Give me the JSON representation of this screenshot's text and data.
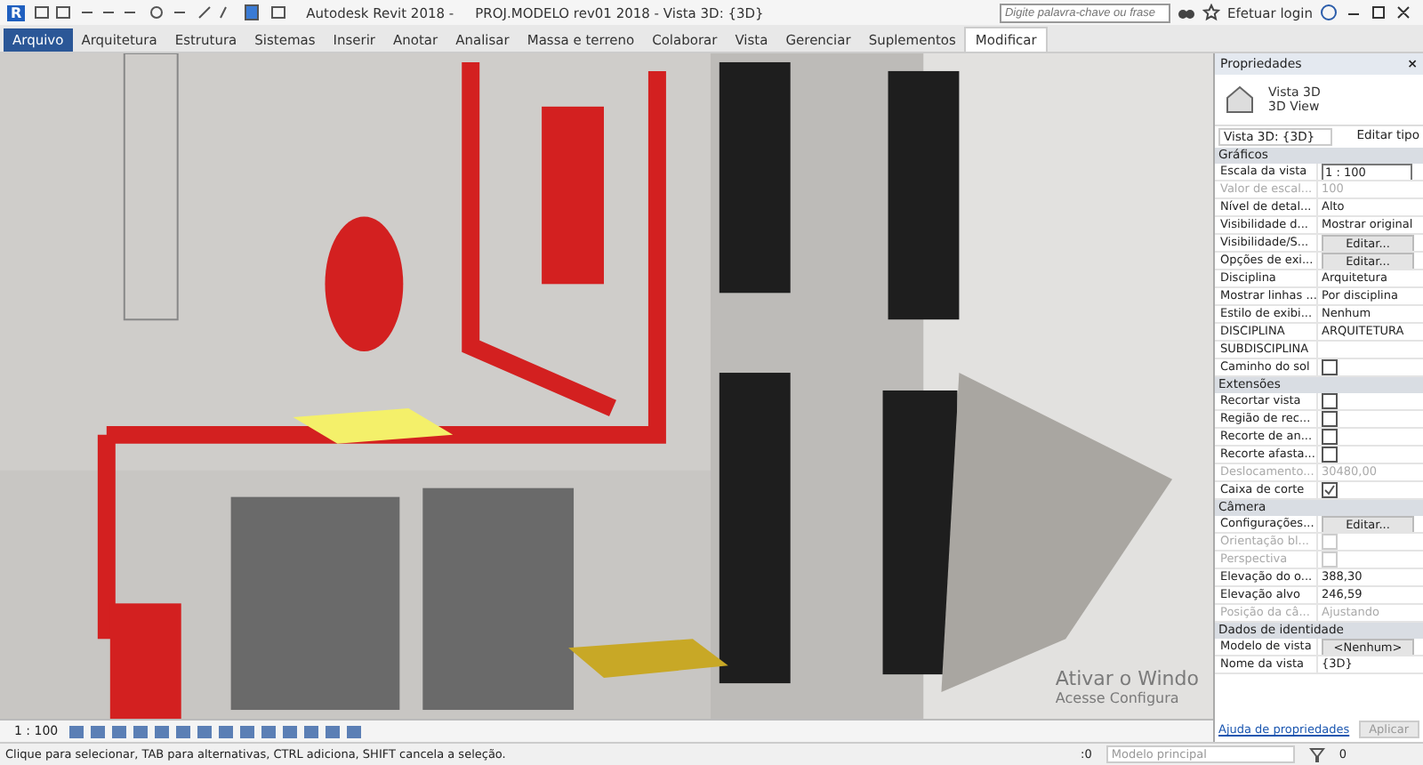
{
  "title_bar": {
    "logo": "R",
    "app": "Autodesk Revit 2018 -",
    "document": "PROJ.MODELO rev01 2018 - Vista 3D: {3D}",
    "search": {
      "placeholder": "Digite palavra-chave ou frase"
    },
    "login": "Efetuar login"
  },
  "tabs": [
    {
      "label": "Arquivo",
      "selected": false,
      "kind": "file"
    },
    {
      "label": "Arquitetura",
      "selected": false,
      "kind": "tab"
    },
    {
      "label": "Estrutura",
      "selected": false,
      "kind": "tab"
    },
    {
      "label": "Sistemas",
      "selected": false,
      "kind": "tab"
    },
    {
      "label": "Inserir",
      "selected": false,
      "kind": "tab"
    },
    {
      "label": "Anotar",
      "selected": false,
      "kind": "tab"
    },
    {
      "label": "Analisar",
      "selected": false,
      "kind": "tab"
    },
    {
      "label": "Massa e terreno",
      "selected": false,
      "kind": "tab"
    },
    {
      "label": "Colaborar",
      "selected": false,
      "kind": "tab"
    },
    {
      "label": "Vista",
      "selected": false,
      "kind": "tab"
    },
    {
      "label": "Gerenciar",
      "selected": false,
      "kind": "tab"
    },
    {
      "label": "Suplementos",
      "selected": false,
      "kind": "tab"
    },
    {
      "label": "Modificar",
      "selected": true,
      "kind": "tab"
    }
  ],
  "viewport": {
    "watermark_lines": [
      "Ativar o Windo",
      "Acesse Configura"
    ]
  },
  "properties": {
    "title": "Propriedades",
    "close": "×",
    "type_name": "Vista 3D",
    "type_sub": "3D View",
    "instance": "Vista 3D: {3D}",
    "edit_type": "Editar tipo",
    "sections": [
      {
        "title": "Gráficos",
        "rows": [
          {
            "label": "Escala da vista",
            "kind": "input",
            "value": "1 : 100",
            "disabled": false
          },
          {
            "label": "Valor de escal...",
            "kind": "text",
            "value": "100",
            "disabled": true
          },
          {
            "label": "Nível de detal...",
            "kind": "text",
            "value": "Alto",
            "disabled": false
          },
          {
            "label": "Visibilidade d...",
            "kind": "text",
            "value": "Mostrar original",
            "disabled": false
          },
          {
            "label": "Visibilidade/S...",
            "kind": "button",
            "value": "Editar...",
            "disabled": false
          },
          {
            "label": "Opções de exi...",
            "kind": "button",
            "value": "Editar...",
            "disabled": false
          },
          {
            "label": "Disciplina",
            "kind": "text",
            "value": "Arquitetura",
            "disabled": false
          },
          {
            "label": "Mostrar linhas ...",
            "kind": "text",
            "value": "Por disciplina",
            "disabled": false
          },
          {
            "label": "Estilo de exibi...",
            "kind": "text",
            "value": "Nenhum",
            "disabled": false
          },
          {
            "label": "DISCIPLINA",
            "kind": "text",
            "value": "ARQUITETURA",
            "disabled": false
          },
          {
            "label": "SUBDISCIPLINA",
            "kind": "text",
            "value": "",
            "disabled": false
          },
          {
            "label": "Caminho do sol",
            "kind": "checkbox",
            "checked": false,
            "disabled": false
          }
        ]
      },
      {
        "title": "Extensões",
        "rows": [
          {
            "label": "Recortar vista",
            "kind": "checkbox",
            "checked": false,
            "disabled": false
          },
          {
            "label": "Região de rec...",
            "kind": "checkbox",
            "checked": false,
            "disabled": false
          },
          {
            "label": "Recorte de an...",
            "kind": "checkbox",
            "checked": false,
            "disabled": false
          },
          {
            "label": "Recorte afasta...",
            "kind": "checkbox",
            "checked": false,
            "disabled": false
          },
          {
            "label": "Deslocamento...",
            "kind": "text",
            "value": "30480,00",
            "disabled": true
          },
          {
            "label": "Caixa de corte",
            "kind": "checkbox",
            "checked": true,
            "disabled": false
          }
        ]
      },
      {
        "title": "Câmera",
        "rows": [
          {
            "label": "Configurações...",
            "kind": "button",
            "value": "Editar...",
            "disabled": false
          },
          {
            "label": "Orientação bl...",
            "kind": "checkbox",
            "checked": false,
            "disabled": true
          },
          {
            "label": "Perspectiva",
            "kind": "checkbox",
            "checked": false,
            "disabled": true
          },
          {
            "label": "Elevação do o...",
            "kind": "text",
            "value": "388,30",
            "disabled": false
          },
          {
            "label": "Elevação alvo",
            "kind": "text",
            "value": "246,59",
            "disabled": false
          },
          {
            "label": "Posição da câ...",
            "kind": "text",
            "value": "Ajustando",
            "disabled": true
          }
        ]
      },
      {
        "title": "Dados de identidade",
        "rows": [
          {
            "label": "Modelo de vista",
            "kind": "button",
            "value": "<Nenhum>",
            "disabled": false
          },
          {
            "label": "Nome da vista",
            "kind": "text",
            "value": "{3D}",
            "disabled": false
          }
        ]
      }
    ],
    "help_link": "Ajuda de propriedades",
    "apply": "Aplicar"
  },
  "view_bar": {
    "scale": "1 : 100"
  },
  "status_bar": {
    "message": "Clique para selecionar, TAB para alternativas, CTRL adiciona, SHIFT cancela a seleção.",
    "filter_count": ":0",
    "model": "Modelo principal",
    "select_count": "0"
  }
}
